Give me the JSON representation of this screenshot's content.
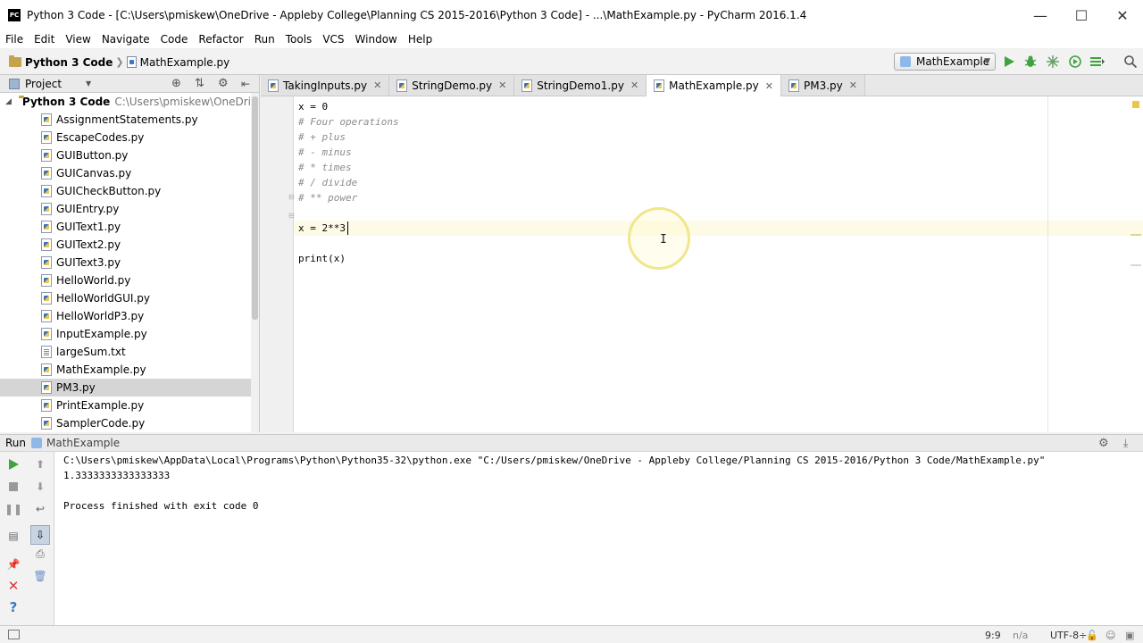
{
  "window": {
    "title": "Python 3 Code - [C:\\Users\\pmiskew\\OneDrive - Appleby College\\Planning CS 2015-2016\\Python 3 Code] - ...\\MathExample.py - PyCharm 2016.1.4",
    "app_icon_text": "PC",
    "minimize": "—",
    "maximize": "☐",
    "close": "✕"
  },
  "menu": [
    "File",
    "Edit",
    "View",
    "Navigate",
    "Code",
    "Refactor",
    "Run",
    "Tools",
    "VCS",
    "Window",
    "Help"
  ],
  "breadcrumb": {
    "project": "Python 3 Code",
    "file": "MathExample.py"
  },
  "run_config": {
    "selected": "MathExample"
  },
  "project_panel": {
    "title": "Project",
    "root_label": "Python 3 Code",
    "root_path": "C:\\Users\\pmiskew\\OneDrive - A",
    "files": [
      {
        "name": "AssignmentStatements.py",
        "type": "py"
      },
      {
        "name": "EscapeCodes.py",
        "type": "py"
      },
      {
        "name": "GUIButton.py",
        "type": "py"
      },
      {
        "name": "GUICanvas.py",
        "type": "py"
      },
      {
        "name": "GUICheckButton.py",
        "type": "py"
      },
      {
        "name": "GUIEntry.py",
        "type": "py"
      },
      {
        "name": "GUIText1.py",
        "type": "py"
      },
      {
        "name": "GUIText2.py",
        "type": "py"
      },
      {
        "name": "GUIText3.py",
        "type": "py"
      },
      {
        "name": "HelloWorld.py",
        "type": "py"
      },
      {
        "name": "HelloWorldGUI.py",
        "type": "py"
      },
      {
        "name": "HelloWorldP3.py",
        "type": "py"
      },
      {
        "name": "InputExample.py",
        "type": "py"
      },
      {
        "name": "largeSum.txt",
        "type": "txt"
      },
      {
        "name": "MathExample.py",
        "type": "py"
      },
      {
        "name": "PM3.py",
        "type": "py",
        "selected": true
      },
      {
        "name": "PrintExample.py",
        "type": "py"
      },
      {
        "name": "SamplerCode.py",
        "type": "py"
      }
    ]
  },
  "tabs": [
    {
      "label": "TakingInputs.py",
      "active": false
    },
    {
      "label": "StringDemo.py",
      "active": false
    },
    {
      "label": "StringDemo1.py",
      "active": false
    },
    {
      "label": "MathExample.py",
      "active": true
    },
    {
      "label": "PM3.py",
      "active": false
    }
  ],
  "tab_close": "✕",
  "code_lines": [
    {
      "text": "x = 0",
      "comment": false
    },
    {
      "text": "# Four operations",
      "comment": true
    },
    {
      "text": "# + plus",
      "comment": true
    },
    {
      "text": "# - minus",
      "comment": true
    },
    {
      "text": "# * times",
      "comment": true
    },
    {
      "text": "# / divide",
      "comment": true
    },
    {
      "text": "# ** power",
      "comment": true
    },
    {
      "text": "",
      "comment": false
    },
    {
      "text": "x = 2**3",
      "comment": false
    },
    {
      "text": "",
      "comment": false
    },
    {
      "text": "print(x)",
      "comment": false
    }
  ],
  "run_panel": {
    "label": "Run",
    "config": "MathExample",
    "console": [
      "C:\\Users\\pmiskew\\AppData\\Local\\Programs\\Python\\Python35-32\\python.exe \"C:/Users/pmiskew/OneDrive - Appleby College/Planning CS 2015-2016/Python 3 Code/MathExample.py\"",
      "1.3333333333333333",
      "",
      "Process finished with exit code 0"
    ]
  },
  "status": {
    "position": "9:9",
    "na": "n/a",
    "encoding": "UTF-8÷"
  },
  "colors": {
    "accent_green": "#3fa33f",
    "selection": "#d5d5d5",
    "caret_row": "#fdfae6",
    "comment": "#8c8c8c"
  }
}
